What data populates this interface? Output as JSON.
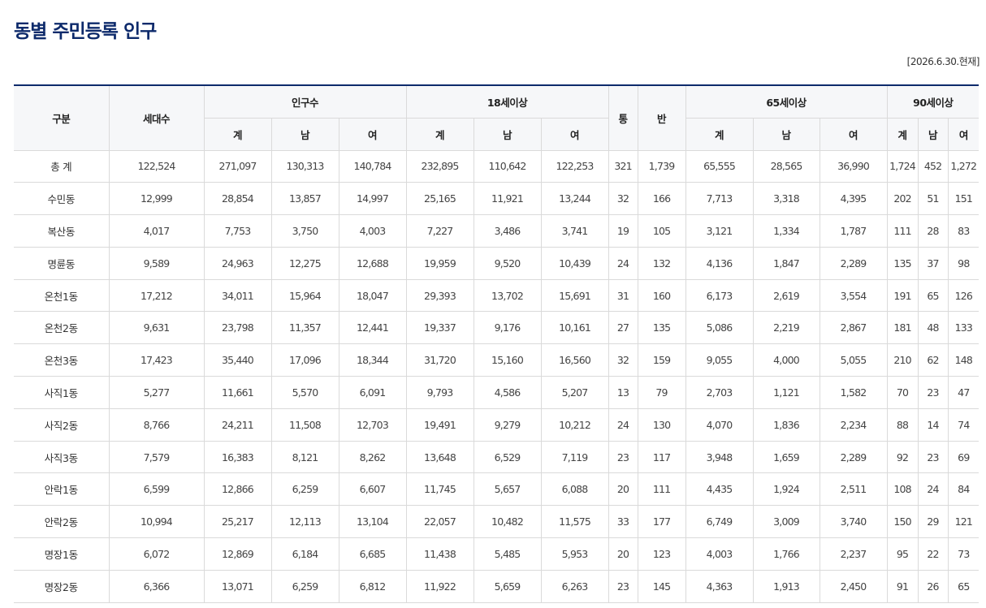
{
  "title": "동별 주민등록 인구",
  "as_of": "[2026.6.30.현재]",
  "header": {
    "gubun": "구분",
    "households": "세대수",
    "population": "인구수",
    "adult18": "18세이상",
    "tong": "통",
    "ban": "반",
    "senior65": "65세이상",
    "senior90": "90세이상",
    "total": "계",
    "male": "남",
    "female": "여"
  },
  "rows": [
    {
      "name": "총 계",
      "v": [
        "122,524",
        "271,097",
        "130,313",
        "140,784",
        "232,895",
        "110,642",
        "122,253",
        "321",
        "1,739",
        "65,555",
        "28,565",
        "36,990",
        "1,724",
        "452",
        "1,272"
      ]
    },
    {
      "name": "수민동",
      "v": [
        "12,999",
        "28,854",
        "13,857",
        "14,997",
        "25,165",
        "11,921",
        "13,244",
        "32",
        "166",
        "7,713",
        "3,318",
        "4,395",
        "202",
        "51",
        "151"
      ]
    },
    {
      "name": "복산동",
      "v": [
        "4,017",
        "7,753",
        "3,750",
        "4,003",
        "7,227",
        "3,486",
        "3,741",
        "19",
        "105",
        "3,121",
        "1,334",
        "1,787",
        "111",
        "28",
        "83"
      ]
    },
    {
      "name": "명륜동",
      "v": [
        "9,589",
        "24,963",
        "12,275",
        "12,688",
        "19,959",
        "9,520",
        "10,439",
        "24",
        "132",
        "4,136",
        "1,847",
        "2,289",
        "135",
        "37",
        "98"
      ]
    },
    {
      "name": "온천1동",
      "v": [
        "17,212",
        "34,011",
        "15,964",
        "18,047",
        "29,393",
        "13,702",
        "15,691",
        "31",
        "160",
        "6,173",
        "2,619",
        "3,554",
        "191",
        "65",
        "126"
      ]
    },
    {
      "name": "온천2동",
      "v": [
        "9,631",
        "23,798",
        "11,357",
        "12,441",
        "19,337",
        "9,176",
        "10,161",
        "27",
        "135",
        "5,086",
        "2,219",
        "2,867",
        "181",
        "48",
        "133"
      ]
    },
    {
      "name": "온천3동",
      "v": [
        "17,423",
        "35,440",
        "17,096",
        "18,344",
        "31,720",
        "15,160",
        "16,560",
        "32",
        "159",
        "9,055",
        "4,000",
        "5,055",
        "210",
        "62",
        "148"
      ]
    },
    {
      "name": "사직1동",
      "v": [
        "5,277",
        "11,661",
        "5,570",
        "6,091",
        "9,793",
        "4,586",
        "5,207",
        "13",
        "79",
        "2,703",
        "1,121",
        "1,582",
        "70",
        "23",
        "47"
      ]
    },
    {
      "name": "사직2동",
      "v": [
        "8,766",
        "24,211",
        "11,508",
        "12,703",
        "19,491",
        "9,279",
        "10,212",
        "24",
        "130",
        "4,070",
        "1,836",
        "2,234",
        "88",
        "14",
        "74"
      ]
    },
    {
      "name": "사직3동",
      "v": [
        "7,579",
        "16,383",
        "8,121",
        "8,262",
        "13,648",
        "6,529",
        "7,119",
        "23",
        "117",
        "3,948",
        "1,659",
        "2,289",
        "92",
        "23",
        "69"
      ]
    },
    {
      "name": "안락1동",
      "v": [
        "6,599",
        "12,866",
        "6,259",
        "6,607",
        "11,745",
        "5,657",
        "6,088",
        "20",
        "111",
        "4,435",
        "1,924",
        "2,511",
        "108",
        "24",
        "84"
      ]
    },
    {
      "name": "안락2동",
      "v": [
        "10,994",
        "25,217",
        "12,113",
        "13,104",
        "22,057",
        "10,482",
        "11,575",
        "33",
        "177",
        "6,749",
        "3,009",
        "3,740",
        "150",
        "29",
        "121"
      ]
    },
    {
      "name": "명장1동",
      "v": [
        "6,072",
        "12,869",
        "6,184",
        "6,685",
        "11,438",
        "5,485",
        "5,953",
        "20",
        "123",
        "4,003",
        "1,766",
        "2,237",
        "95",
        "22",
        "73"
      ]
    },
    {
      "name": "명장2동",
      "v": [
        "6,366",
        "13,071",
        "6,259",
        "6,812",
        "11,922",
        "5,659",
        "6,263",
        "23",
        "145",
        "4,363",
        "1,913",
        "2,450",
        "91",
        "26",
        "65"
      ]
    }
  ],
  "colors": {
    "title": "#0d2a6b",
    "header_bg": "#f6f7f9",
    "border": "#dadada",
    "top_rule": "#0d2a6b"
  }
}
